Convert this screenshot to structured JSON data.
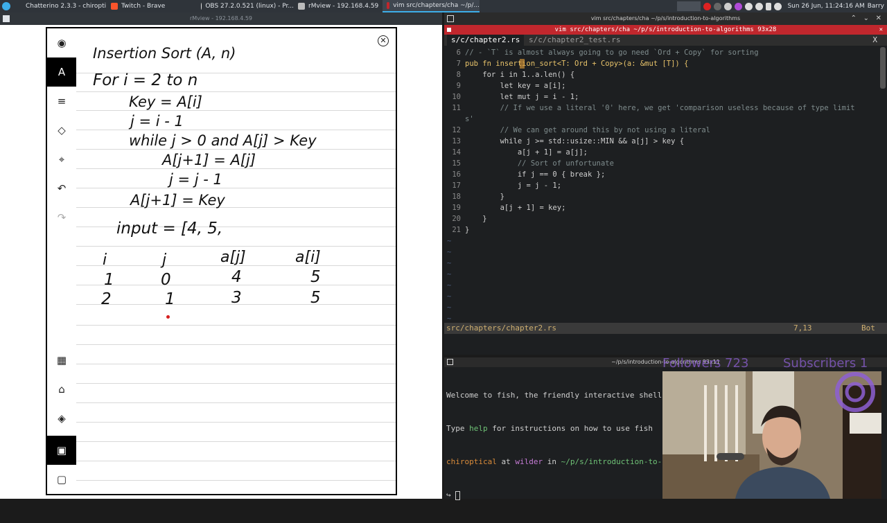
{
  "taskbar": {
    "apps": [
      {
        "label": "Chatterino 2.3.3 - chiropti..."
      },
      {
        "label": "Twitch - Brave"
      },
      {
        "label": "OBS 27.2.0.521 (linux) - Pr..."
      },
      {
        "label": "rMview - 192.168.4.59"
      },
      {
        "label": "vim src/chapters/cha ~/p/..."
      }
    ],
    "clock": "Sun 26 Jun, 11:24:16 AM",
    "user": "Barry"
  },
  "rmview": {
    "title": "rMview - 192.168.4.59",
    "close_glyph": "✕",
    "tools": [
      {
        "glyph": "◉"
      },
      {
        "glyph": "A"
      },
      {
        "glyph": "≡"
      },
      {
        "glyph": "◇"
      },
      {
        "glyph": "⌖"
      },
      {
        "glyph": "↶"
      },
      {
        "glyph": "↷"
      },
      {
        "glyph": "▦"
      },
      {
        "glyph": "⌂"
      },
      {
        "glyph": "◈"
      },
      {
        "glyph": "▣"
      },
      {
        "glyph": "▢"
      }
    ],
    "notes": {
      "title": "Insertion Sort (A, n)",
      "l1": "For i = 2 to n",
      "l2": "Key = A[i]",
      "l3": "j = i - 1",
      "l4": "while j > 0 and A[j] > Key",
      "l5": "A[j+1] = A[j]",
      "l6": "j = j - 1",
      "l7": "A[j+1] = Key",
      "l8": "input = [4, 5,",
      "table_headers": [
        "i",
        "j",
        "a[j]",
        "a[i]"
      ],
      "table_rows": [
        [
          "1",
          "0",
          "4",
          "5"
        ],
        [
          "2",
          "1",
          "3",
          "5"
        ]
      ]
    }
  },
  "vim": {
    "window_title": "vim src/chapters/cha ~/p/s/introduction-to-algorithms",
    "tab_title": "vim src/chapters/cha ~/p/s/introduction-to-algorithms 93x28",
    "buffers": [
      "s/c/chapter2.rs",
      "s/c/chapter2_test.rs"
    ],
    "close_glyph": "X",
    "code_lines": [
      {
        "n": "6",
        "text": "// - `T` is almost always going to go need `Ord + Copy` for sorting"
      },
      {
        "n": "7",
        "text": "pub fn insertion_sort<T: Ord + Copy>(a: &mut [T]) {"
      },
      {
        "n": "8",
        "text": "    for i in 1..a.len() {"
      },
      {
        "n": "9",
        "text": "        let key = a[i];"
      },
      {
        "n": "10",
        "text": "        let mut j = i - 1;"
      },
      {
        "n": "11",
        "text": "        // If we use a literal '0' here, we get 'comparison useless because of type limit"
      },
      {
        "n": "",
        "text": "s'"
      },
      {
        "n": "12",
        "text": "        // We can get around this by not using a literal"
      },
      {
        "n": "13",
        "text": "        while j >= std::usize::MIN && a[j] > key {"
      },
      {
        "n": "14",
        "text": "            a[j + 1] = a[j];"
      },
      {
        "n": "15",
        "text": "            // Sort of unfortunate"
      },
      {
        "n": "16",
        "text": "            if j == 0 { break };"
      },
      {
        "n": "17",
        "text": "            j = j - 1;"
      },
      {
        "n": "18",
        "text": "        }"
      },
      {
        "n": "19",
        "text": "        a[j + 1] = key;"
      },
      {
        "n": "20",
        "text": "    }"
      },
      {
        "n": "21",
        "text": "}"
      }
    ],
    "tildes": [
      "~",
      "~",
      "~",
      "~",
      "~",
      "~",
      "~",
      "~"
    ],
    "status_file": "src/chapters/chapter2.rs",
    "status_pos": "7,13",
    "status_scroll": "Bot"
  },
  "fish": {
    "title": "~/p/s/introduction-to-algorithms 93x11",
    "line1": "Welcome to fish, the friendly interactive shell",
    "line2_pre": "Type ",
    "line2_help": "help",
    "line2_post": " for instructions on how to use fish",
    "prompt_user": "chiroptical",
    "prompt_at": " at ",
    "prompt_host": "wilder",
    "prompt_in": " in ",
    "prompt_path": "~/p/s/introduction-to-",
    "prompt_symbol": "↪"
  },
  "overlay": {
    "followers": "Followers 723",
    "subscribers": "Subscribers 1"
  }
}
